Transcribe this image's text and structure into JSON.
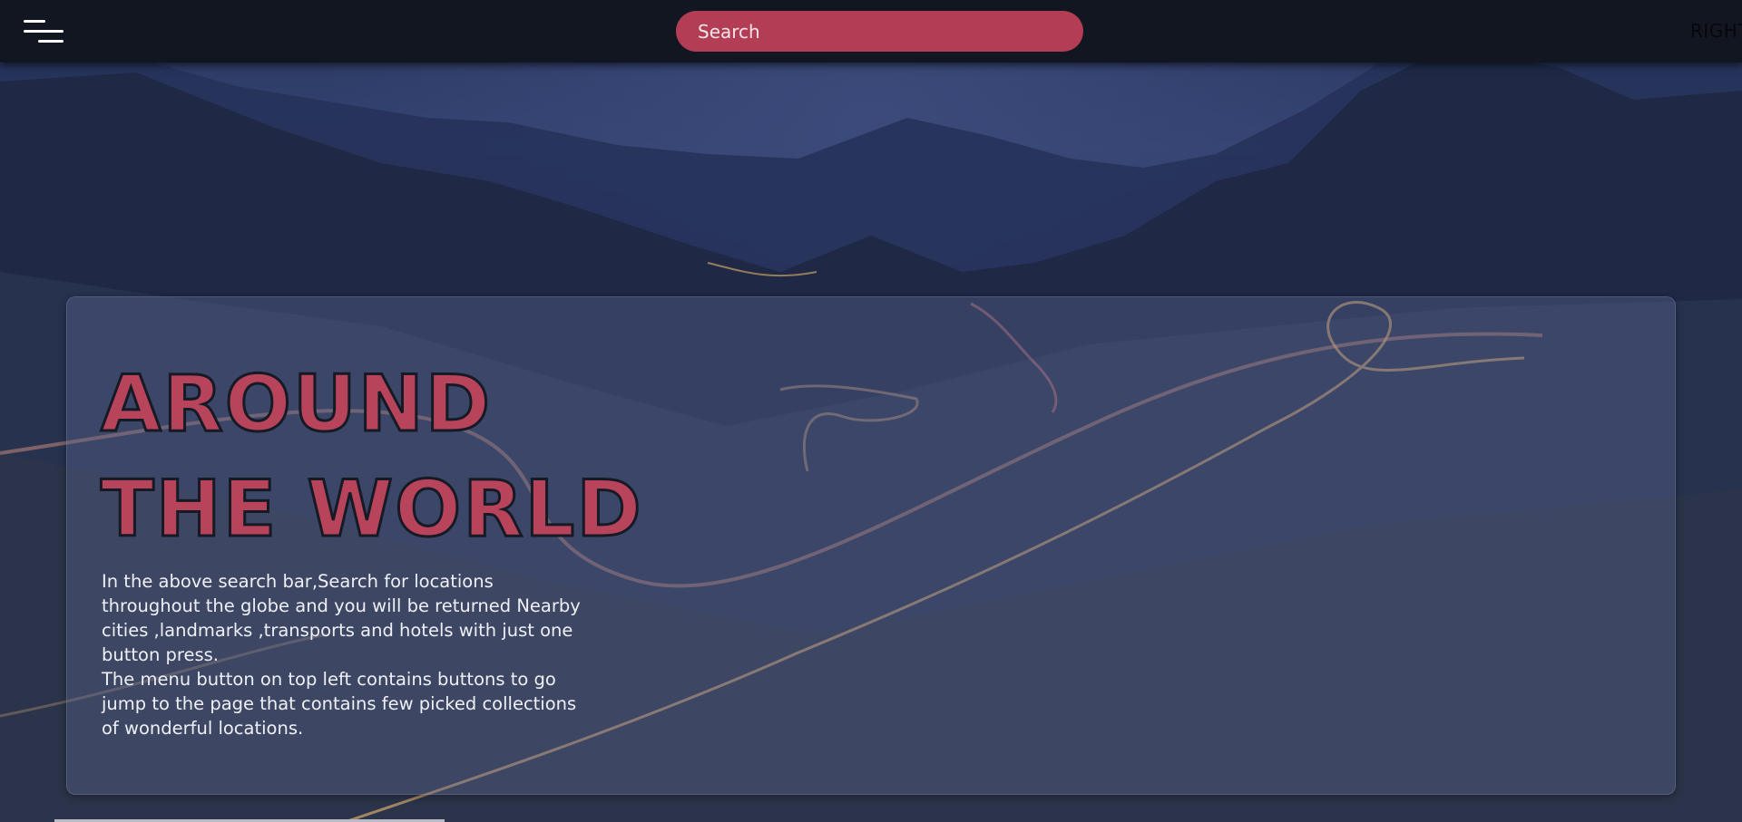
{
  "topbar": {
    "menu_icon": "hamburger-menu-icon",
    "search_placeholder": "Search",
    "right_label": "RIGHT",
    "search_color": "#b33d54"
  },
  "hero": {
    "title_line1": "AROUND",
    "title_line2": "THE WORLD",
    "title_color": "#b8445c",
    "paragraph1": "In the above search bar,Search for locations throughout the globe and you will be returned Nearby cities ,landmarks ,transports and hotels with just one button press.",
    "paragraph2": "The menu button on top left contains buttons to go jump to the page that contains few picked collections of wonderful locations."
  }
}
